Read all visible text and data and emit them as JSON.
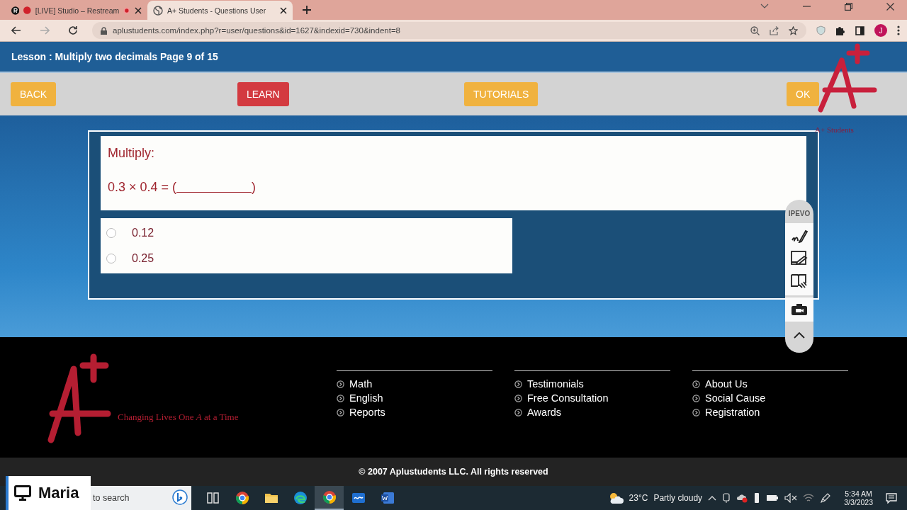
{
  "browser": {
    "tabs": [
      {
        "title": "[LIVE] Studio – Restream",
        "selected": false,
        "recording": true
      },
      {
        "title": "A+ Students - Questions User",
        "selected": true,
        "recording": false
      }
    ],
    "url": "aplustudents.com/index.php?r=user/questions&id=1627&indexid=730&indent=8",
    "profile_initial": "J"
  },
  "page": {
    "lesson_title": "Lesson : Multiply two decimals Page 9 of 15",
    "nav_buttons": [
      {
        "label": "BACK",
        "kind": "secondary"
      },
      {
        "label": "LEARN",
        "kind": "primary"
      },
      {
        "label": "TUTORIALS",
        "kind": "secondary"
      },
      {
        "label": "OK",
        "kind": "secondary"
      }
    ],
    "brand": "A+ Students",
    "question": {
      "prompt": "Multiply:",
      "equation_before": "0.3 × 0.4 = (",
      "equation_after": ")"
    },
    "options": [
      {
        "label": "0.12",
        "selected": false
      },
      {
        "label": "0.25",
        "selected": false
      }
    ]
  },
  "ipevo_toolbar": {
    "label": "IPEVO"
  },
  "footer": {
    "tagline": "Changing Lives One *A* at a Time",
    "columns": [
      [
        "Math",
        "English",
        "Reports"
      ],
      [
        "Testimonials",
        "Free Consultation",
        "Awards"
      ],
      [
        "About Us",
        "Social Cause",
        "Registration"
      ]
    ],
    "copyright": "© 2007 Aplustudents LLC. All rights reserved"
  },
  "presenter_label": "Maria",
  "taskbar": {
    "search_placeholder": "to search",
    "pinned_apps": [
      {
        "kind": "taskview",
        "active": false
      },
      {
        "kind": "chrome",
        "active": false
      },
      {
        "kind": "files",
        "active": false
      },
      {
        "kind": "edge",
        "active": false
      },
      {
        "kind": "chrome",
        "active": true
      },
      {
        "kind": "whiteboard",
        "active": false
      },
      {
        "kind": "word",
        "active": false
      }
    ],
    "weather": {
      "temperature": "23°C",
      "condition": "Partly cloudy"
    },
    "time": "5:34 AM",
    "date": "3/3/2023"
  }
}
